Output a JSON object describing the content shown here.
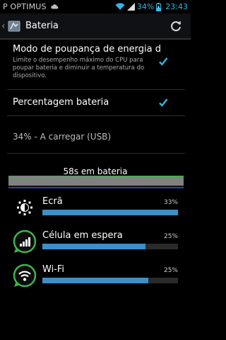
{
  "statusbar": {
    "carrier": "P OPTIMUS",
    "battery_percent": "34%",
    "time": "23:43"
  },
  "actionbar": {
    "title": "Bateria",
    "icons": [
      "settings-icon",
      "refresh-icon"
    ]
  },
  "prefs": {
    "power_saving": {
      "title": "Modo de poupança de energia d",
      "summary": "Limite o desempenho máximo do CPU para poupar bateria e diminuir a temperatura do dispositivo.",
      "checked": true
    },
    "battery_percentage": {
      "title": "Percentagem bateria",
      "checked": true
    }
  },
  "battery_status": "34% - A carregar (USB)",
  "graph": {
    "label": "58s em bateria",
    "line_color": "#3fb34f"
  },
  "usage": [
    {
      "name": "Ecrã",
      "percent": "33%",
      "fill": 1.0,
      "icon": "brightness-icon"
    },
    {
      "name": "Célula em espera",
      "percent": "25%",
      "fill": 0.76,
      "icon": "signal-icon"
    },
    {
      "name": "Wi-Fi",
      "percent": "25%",
      "fill": 0.78,
      "icon": "wifi-icon"
    }
  ],
  "colors": {
    "accent": "#33b5e5",
    "bar": "#3e8ec8",
    "icon_ring": "#3fb34f"
  }
}
